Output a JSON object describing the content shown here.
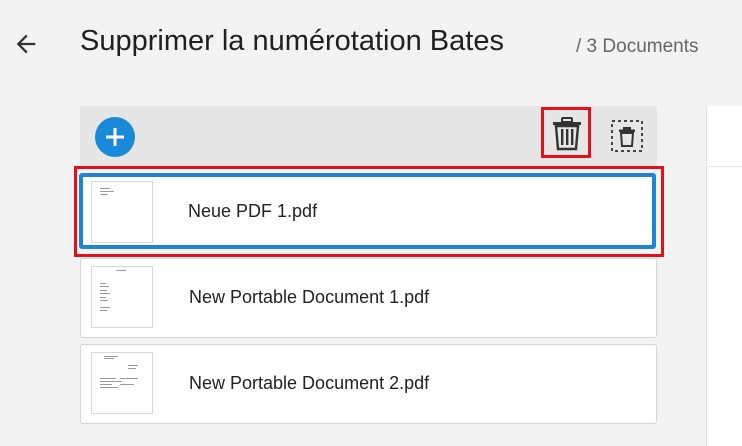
{
  "header": {
    "back_icon": "arrow-left-icon",
    "title": "Supprimer la numérotation Bates",
    "doc_count": "/ 3 Documents"
  },
  "toolbar": {
    "add_icon": "plus-icon",
    "delete_icon": "trash-icon",
    "deselect_icon": "deselect-dashed-trash-icon",
    "accent_color": "#1a8ad8",
    "highlight_color": "#e4111a"
  },
  "documents": [
    {
      "name": "Neue PDF 1.pdf",
      "selected": true
    },
    {
      "name": "New Portable Document 1.pdf",
      "selected": false
    },
    {
      "name": "New Portable Document 2.pdf",
      "selected": false
    }
  ]
}
